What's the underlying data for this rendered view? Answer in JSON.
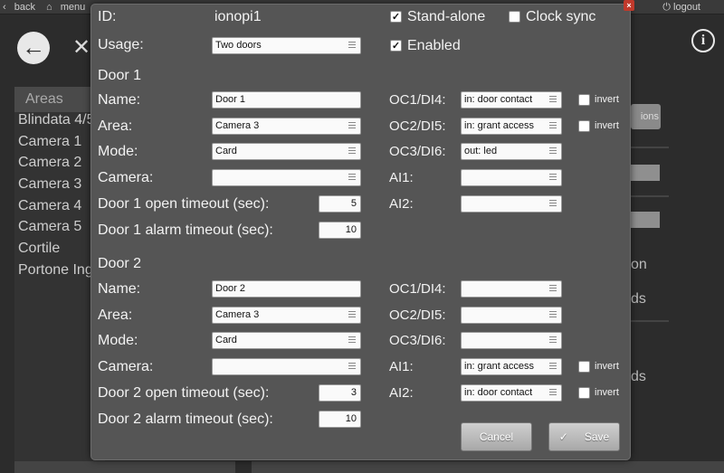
{
  "topbar": {
    "back_label": "back",
    "menu_label": "menu",
    "logout_label": "logout"
  },
  "background": {
    "areas_header": "Areas",
    "areas": [
      "Blindata 4/5",
      "Camera 1",
      "Camera 2",
      "Camera 3",
      "Camera 4",
      "Camera 5",
      "Cortile",
      "Portone Ingresso"
    ],
    "right_button": "ions",
    "right_text_1": "on",
    "right_text_2": "ds",
    "right_text_3": "ds"
  },
  "dialog": {
    "id_label": "ID:",
    "id_value": "ionopi1",
    "standalone_label": "Stand-alone",
    "standalone_checked": "✓",
    "clocksync_label": "Clock sync",
    "clocksync_checked": "",
    "usage_label": "Usage:",
    "usage_value": "Two doors",
    "enabled_label": "Enabled",
    "enabled_checked": "✓",
    "invert_label": "invert",
    "cancel_label": "Cancel",
    "save_label": "Save",
    "save_check": "✓",
    "door1": {
      "title": "Door 1",
      "name_label": "Name:",
      "name_value": "Door 1",
      "area_label": "Area:",
      "area_value": "Camera 3",
      "mode_label": "Mode:",
      "mode_value": "Card",
      "camera_label": "Camera:",
      "camera_value": "",
      "open_timeout_label": "Door 1 open timeout (sec):",
      "open_timeout_value": "5",
      "alarm_timeout_label": "Door 1 alarm timeout (sec):",
      "alarm_timeout_value": "10",
      "oc1_label": "OC1/DI4:",
      "oc1_value": "in: door contact",
      "oc1_invert": "",
      "oc2_label": "OC2/DI5:",
      "oc2_value": "in: grant access",
      "oc2_invert": "",
      "oc3_label": "OC3/DI6:",
      "oc3_value": "out: led",
      "ai1_label": "AI1:",
      "ai1_value": "",
      "ai2_label": "AI2:",
      "ai2_value": ""
    },
    "door2": {
      "title": "Door 2",
      "name_label": "Name:",
      "name_value": "Door 2",
      "area_label": "Area:",
      "area_value": "Camera 3",
      "mode_label": "Mode:",
      "mode_value": "Card",
      "camera_label": "Camera:",
      "camera_value": "",
      "open_timeout_label": "Door 2 open timeout (sec):",
      "open_timeout_value": "3",
      "alarm_timeout_label": "Door 2 alarm timeout (sec):",
      "alarm_timeout_value": "10",
      "oc1_label": "OC1/DI4:",
      "oc1_value": "",
      "oc2_label": "OC2/DI5:",
      "oc2_value": "",
      "oc3_label": "OC3/DI6:",
      "oc3_value": "",
      "ai1_label": "AI1:",
      "ai1_value": "in: grant access",
      "ai1_invert": "",
      "ai2_label": "AI2:",
      "ai2_value": "in: door contact",
      "ai2_invert": ""
    }
  }
}
